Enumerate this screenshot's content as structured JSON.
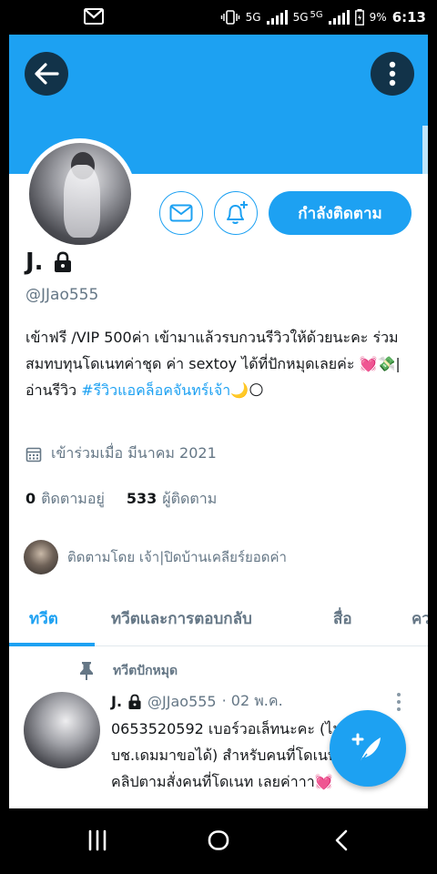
{
  "status_bar": {
    "network1": "5G",
    "network2": "5G",
    "network3": "5G",
    "battery": "9%",
    "time": "6:13"
  },
  "profile": {
    "name": "J.",
    "handle": "@JJao555",
    "bio_text": "เข้าฟรี /VIP 500ค่า เข้ามาแล้วรบกวนรีวิวให้ด้วยนะคะ ร่วมสมทบทุนโดเนทค่าชุด ค่า sextoy ได้ที่ปักหมุดเลยค่ะ 💓💸|อ่านรีวิว ",
    "bio_hashtag": "#รีวิวแอคล็อคจันทร์เจ้า",
    "bio_end": "🌙🌕",
    "joined": "เข้าร่วมเมื่อ มีนาคม 2021",
    "following_count": "0",
    "following_label": "ติดตามอยู่",
    "followers_count": "533",
    "followers_label": "ผู้ติดตาม",
    "followed_by": "ติดตามโดย เจ้า|ปิดบ้านเคลียร์ยอดค่า",
    "follow_button": "กำลังติดตาม"
  },
  "tabs": [
    {
      "label": "ทวีต",
      "active": true
    },
    {
      "label": "ทวีตและการตอบกลับ",
      "active": false
    },
    {
      "label": "สื่อ",
      "active": false
    },
    {
      "label": "คว",
      "active": false
    }
  ],
  "pinned_tweet": {
    "pinned_label": "ทวีตปักหมุด",
    "author": "J.",
    "handle": "@JJao555",
    "date": "· 02 พ.ค.",
    "text": "0653520592 เบอร์วอเล็ทนะคะ (ไม่โอน บช.เดมมาขอได้) สำหรับคนที่โดเนทเจ้าจะทำคลิปตามสั่งคนที่โดเนท เลยค่าาา💓"
  },
  "colors": {
    "accent": "#1da1f2",
    "text": "#14171a",
    "secondary": "#657786"
  }
}
